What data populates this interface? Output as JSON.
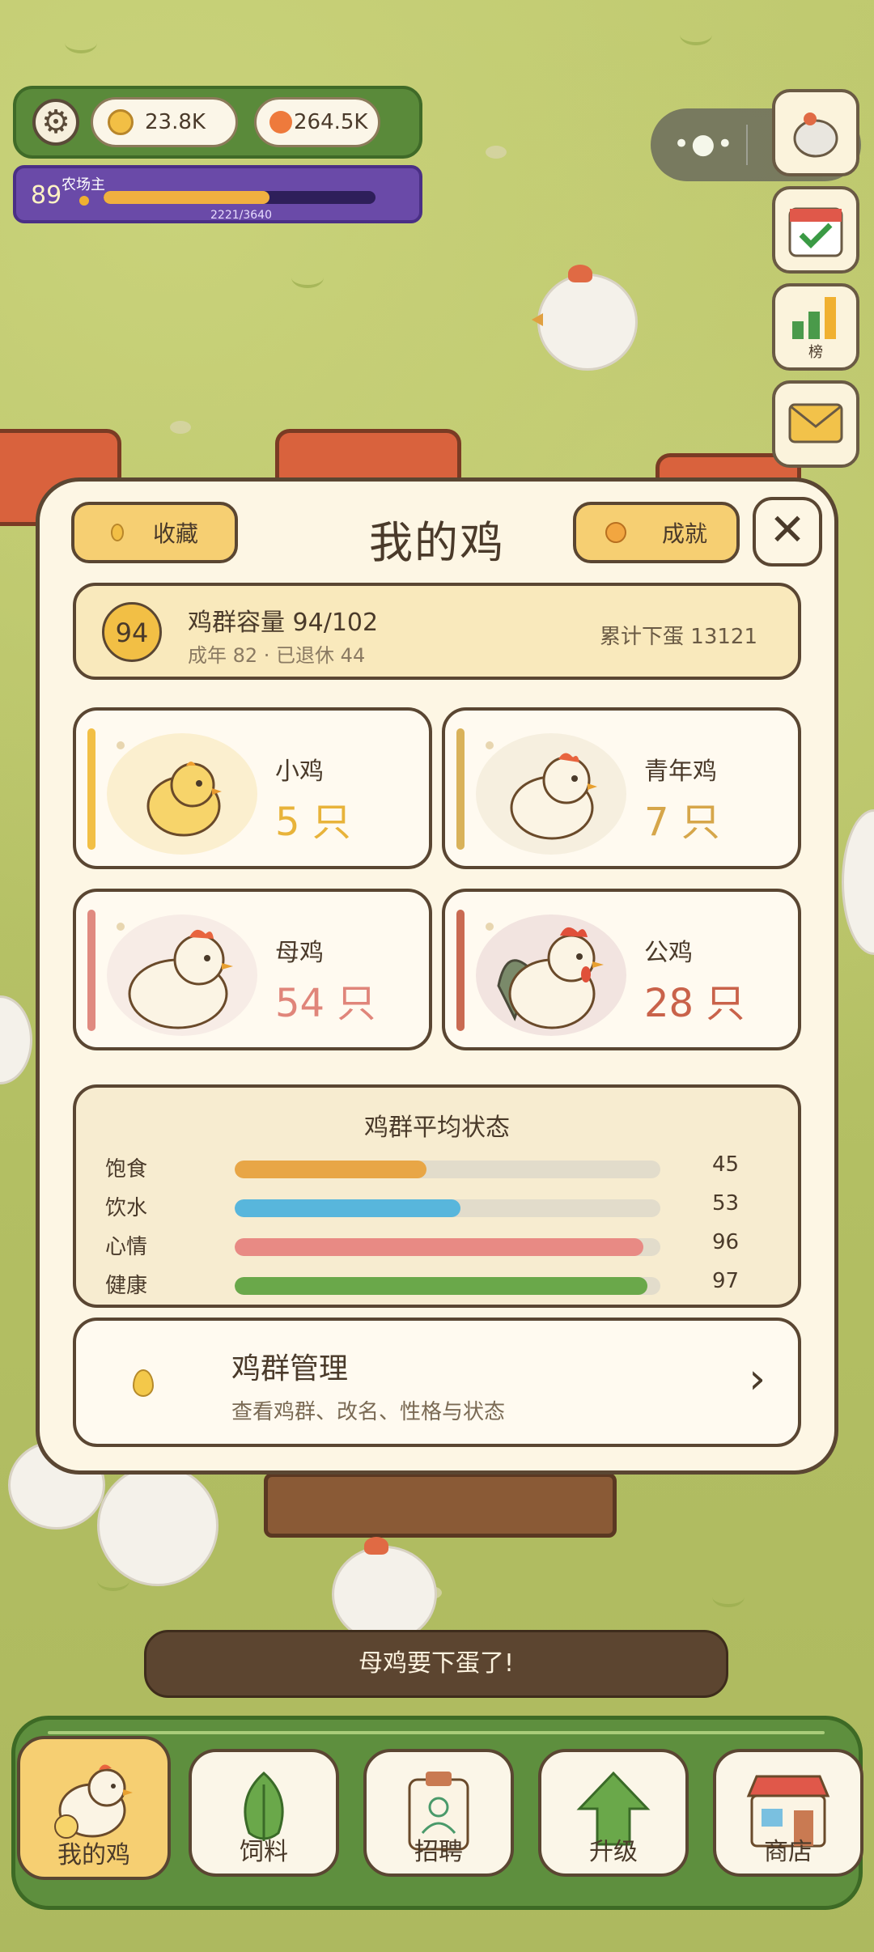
{
  "hud": {
    "coins": "23.8K",
    "gems": "264.5K",
    "level": "89",
    "level_title": "农场主",
    "xp_text": "2221/3640",
    "xp_progress": 0.61
  },
  "side": {
    "rank_label": "榜"
  },
  "modal": {
    "title": "我的鸡",
    "left_button": "收藏",
    "right_button": "成就",
    "close": "✕",
    "capacity_badge": "94",
    "capacity_title": "鸡群容量 94/102",
    "capacity_sub": "成年 82 · 已退休 44",
    "total_eggs": "累计下蛋 13121",
    "cards": [
      {
        "name": "小鸡",
        "count": "5 只",
        "color": "#f2bf45"
      },
      {
        "name": "青年鸡",
        "count": "7 只",
        "color": "#d9b25a"
      },
      {
        "name": "母鸡",
        "count": "54 只",
        "color": "#e08a80"
      },
      {
        "name": "公鸡",
        "count": "28 只",
        "color": "#c96a52"
      }
    ],
    "stats_title": "鸡群平均状态",
    "stats": [
      {
        "label": "饱食",
        "value": "45",
        "pct": 45,
        "color": "#e8a646"
      },
      {
        "label": "饮水",
        "value": "53",
        "pct": 53,
        "color": "#58b6dc"
      },
      {
        "label": "心情",
        "value": "96",
        "pct": 96,
        "color": "#e88a84"
      },
      {
        "label": "健康",
        "value": "97",
        "pct": 97,
        "color": "#6aa84a"
      }
    ],
    "mgmt_title": "鸡群管理",
    "mgmt_sub": "查看鸡群、改名、性格与状态",
    "mgmt_arrow": "›"
  },
  "toast": "母鸡要下蛋了!",
  "nav": [
    {
      "label": "我的鸡",
      "icon": "chicken-icon"
    },
    {
      "label": "饲料",
      "icon": "leaf-icon"
    },
    {
      "label": "招聘",
      "icon": "badge-icon"
    },
    {
      "label": "升级",
      "icon": "arrow-up-icon"
    },
    {
      "label": "商店",
      "icon": "shop-icon"
    }
  ],
  "colors": {
    "accent": "#f6cf72",
    "border": "#5a4632",
    "panel": "#fdf6e4",
    "nav_green": "#5e8f3e"
  }
}
